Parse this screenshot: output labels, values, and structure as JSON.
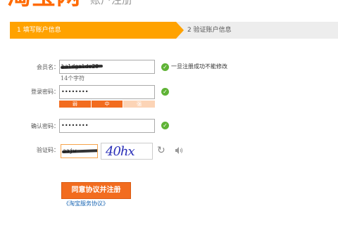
{
  "header": {
    "logo_text": "淘宝网",
    "page_title": "账户注册"
  },
  "steps": [
    {
      "label": "1 填写账户信息",
      "active": true
    },
    {
      "label": "2 验证账户信息",
      "active": false
    }
  ],
  "form": {
    "member_name": {
      "label": "会员名：",
      "value": "baldgalde20",
      "hint": "14个字符",
      "tip": "一旦注册成功不能修改"
    },
    "password": {
      "label": "登录密码：",
      "value": "••••••••",
      "strength": [
        "弱",
        "中",
        "强"
      ]
    },
    "confirm_password": {
      "label": "确认密码：",
      "value": "••••••••"
    },
    "captcha": {
      "label": "验证码：",
      "value": "aajw",
      "image_text": "40hx"
    }
  },
  "submit_label": "同意协议并注册",
  "agreement_link": "《淘宝服务协议》",
  "colors": {
    "accent": "#ffa200",
    "button": "#f26c1f",
    "ok": "#5fb336",
    "link": "#1a66b3"
  }
}
